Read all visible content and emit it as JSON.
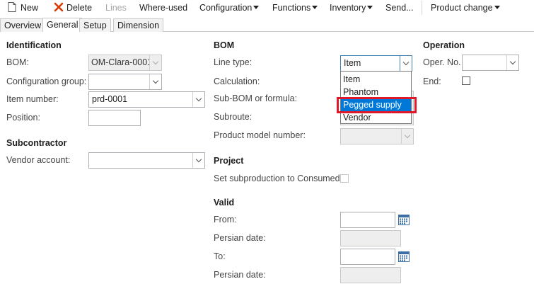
{
  "toolbar": {
    "new": "New",
    "delete": "Delete",
    "lines": "Lines",
    "where_used": "Where-used",
    "configuration": "Configuration",
    "functions": "Functions",
    "inventory": "Inventory",
    "send": "Send...",
    "product_change": "Product change"
  },
  "tabs": {
    "overview": "Overview",
    "general": "General",
    "setup": "Setup",
    "dimension": "Dimension"
  },
  "identification": {
    "header": "Identification",
    "bom_label": "BOM:",
    "bom_value": "OM-Clara-0001",
    "config_group_label": "Configuration group:",
    "config_group_value": "",
    "item_number_label": "Item number:",
    "item_number_value": "prd-0001",
    "position_label": "Position:",
    "position_value": ""
  },
  "subcontractor": {
    "header": "Subcontractor",
    "vendor_account_label": "Vendor account:",
    "vendor_account_value": ""
  },
  "bom": {
    "header": "BOM",
    "line_type_label": "Line type:",
    "line_type_value": "Item",
    "line_type_options": [
      "Item",
      "Phantom",
      "Pegged supply",
      "Vendor"
    ],
    "line_type_selected": "Pegged supply",
    "calculation_label": "Calculation:",
    "sub_bom_label": "Sub-BOM or formula:",
    "subroute_label": "Subroute:",
    "product_model_label": "Product model number:",
    "product_model_value": ""
  },
  "project": {
    "header": "Project",
    "set_subproduction_label": "Set subproduction to Consumed:"
  },
  "valid": {
    "header": "Valid",
    "from_label": "From:",
    "from_value": "",
    "persian_from_label": "Persian date:",
    "to_label": "To:",
    "to_value": "",
    "persian_to_label": "Persian date:"
  },
  "operation": {
    "header": "Operation",
    "oper_no_label": "Oper. No.",
    "oper_no_value": "",
    "end_label": "End:"
  },
  "colors": {
    "selection": "#0078d7",
    "highlight_border": "#e0192a",
    "delete_icon": "#d83b01"
  }
}
